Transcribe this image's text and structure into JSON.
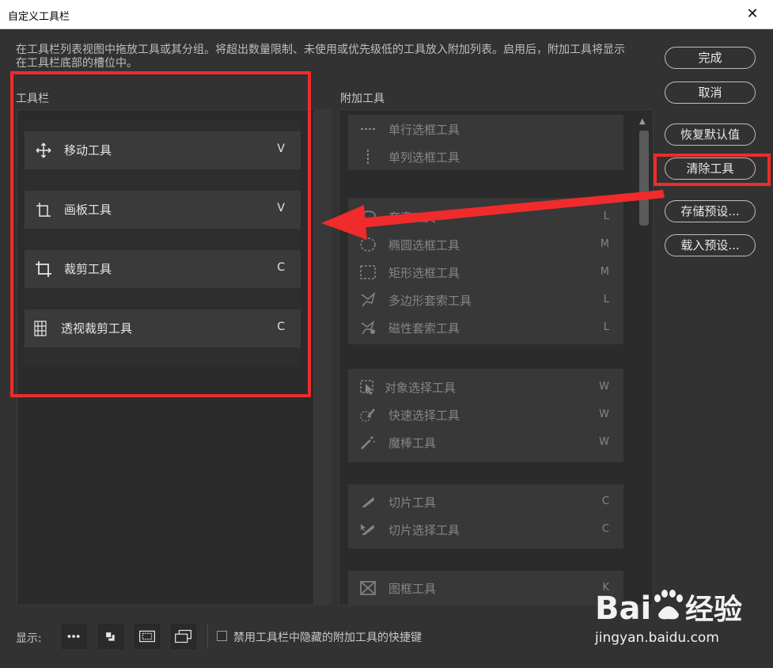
{
  "window": {
    "title": "自定义工具栏",
    "close_glyph": "✕"
  },
  "description": "在工具栏列表视图中拖放工具或其分组。将超出数量限制、未使用或优先级低的工具放入附加列表。启用后，附加工具将显示在工具栏底部的槽位中。",
  "toolbar": {
    "label": "工具栏",
    "items": [
      {
        "name": "移动工具",
        "key": "V",
        "icon": "move-icon"
      },
      {
        "name": "画板工具",
        "key": "V",
        "icon": "artboard-icon"
      },
      {
        "name": "裁剪工具",
        "key": "C",
        "icon": "crop-icon"
      },
      {
        "name": "透视裁剪工具",
        "key": "C",
        "icon": "perspective-crop-icon"
      }
    ]
  },
  "extra": {
    "label": "附加工具",
    "groups": [
      {
        "items": [
          {
            "name": "单行选框工具",
            "key": "",
            "icon": "single-row-marquee-icon"
          },
          {
            "name": "单列选框工具",
            "key": "",
            "icon": "single-column-marquee-icon"
          }
        ]
      },
      {
        "items": [
          {
            "name": "套索工具",
            "key": "L",
            "icon": "lasso-icon"
          },
          {
            "name": "椭圆选框工具",
            "key": "M",
            "icon": "elliptical-marquee-icon"
          },
          {
            "name": "矩形选框工具",
            "key": "M",
            "icon": "rectangular-marquee-icon"
          },
          {
            "name": "多边形套索工具",
            "key": "L",
            "icon": "polygonal-lasso-icon"
          },
          {
            "name": "磁性套索工具",
            "key": "L",
            "icon": "magnetic-lasso-icon"
          }
        ]
      },
      {
        "items": [
          {
            "name": "对象选择工具",
            "key": "W",
            "icon": "object-selection-icon"
          },
          {
            "name": "快速选择工具",
            "key": "W",
            "icon": "quick-selection-icon"
          },
          {
            "name": "魔棒工具",
            "key": "W",
            "icon": "magic-wand-icon"
          }
        ]
      },
      {
        "items": [
          {
            "name": "切片工具",
            "key": "C",
            "icon": "slice-icon"
          },
          {
            "name": "切片选择工具",
            "key": "C",
            "icon": "slice-select-icon"
          }
        ]
      },
      {
        "items": [
          {
            "name": "图框工具",
            "key": "K",
            "icon": "frame-icon"
          }
        ]
      }
    ]
  },
  "buttons": {
    "done": "完成",
    "cancel": "取消",
    "restore": "恢复默认值",
    "clear": "清除工具",
    "save_preset": "存储预设...",
    "load_preset": "载入预设..."
  },
  "footer": {
    "show_label": "显示:",
    "disable_shortcuts_label": "禁用工具栏中隐藏的附加工具的快捷键",
    "disable_shortcuts_checked": false,
    "view_buttons": [
      "more-icon",
      "foreground-background-icon",
      "quick-mask-icon",
      "screen-mode-icon"
    ]
  },
  "watermark": {
    "logo": "Bai",
    "logo_cn": "经验",
    "url": "jingyan.baidu.com"
  },
  "colors": {
    "highlight_red": "#ef2b2b",
    "dialog_bg": "#323232"
  }
}
